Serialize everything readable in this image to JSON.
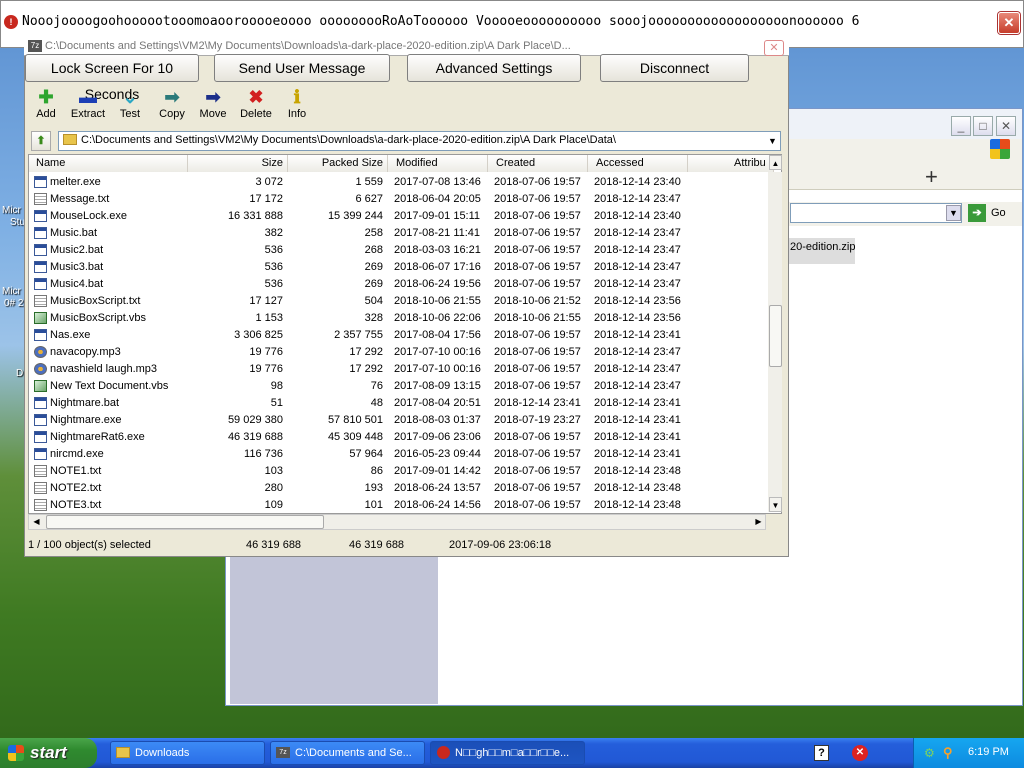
{
  "rat_window": {
    "title": "Nooojoooogoohoooootooomoaoorooooeoooo ooooooooRoAoToooooo Vooooeoooooooooo sooojoooooooooooooooooonoooooo 6",
    "buttons": [
      "Lock Screen For 10 Seconds",
      "Send User Message",
      "Advanced Settings",
      "Disconnect"
    ]
  },
  "zip_window": {
    "title": "C:\\Documents and Settings\\VM2\\My Documents\\Downloads\\a-dark-place-2020-edition.zip\\A Dark Place\\D...",
    "toolbar": [
      {
        "label": "Add",
        "icon": "plus-icon"
      },
      {
        "label": "Extract",
        "icon": "minus-icon"
      },
      {
        "label": "Test",
        "icon": "check-icon"
      },
      {
        "label": "Copy",
        "icon": "copy-arrow-icon"
      },
      {
        "label": "Move",
        "icon": "move-arrow-icon"
      },
      {
        "label": "Delete",
        "icon": "delete-x-icon"
      },
      {
        "label": "Info",
        "icon": "info-icon"
      }
    ],
    "path": "C:\\Documents and Settings\\VM2\\My Documents\\Downloads\\a-dark-place-2020-edition.zip\\A Dark Place\\Data\\",
    "columns": [
      "Name",
      "Size",
      "Packed Size",
      "Modified",
      "Created",
      "Accessed",
      "Attribu"
    ],
    "rows": [
      {
        "type": "exe",
        "name": "melter.exe",
        "size": "3 072",
        "packed": "1 559",
        "modified": "2017-07-08 13:46",
        "created": "2018-07-06 19:57",
        "accessed": "2018-12-14 23:40"
      },
      {
        "type": "txt",
        "name": "Message.txt",
        "size": "17 172",
        "packed": "6 627",
        "modified": "2018-06-04 20:05",
        "created": "2018-07-06 19:57",
        "accessed": "2018-12-14 23:47"
      },
      {
        "type": "exe",
        "name": "MouseLock.exe",
        "size": "16 331 888",
        "packed": "15 399 244",
        "modified": "2017-09-01 15:11",
        "created": "2018-07-06 19:57",
        "accessed": "2018-12-14 23:40"
      },
      {
        "type": "exe",
        "name": "Music.bat",
        "size": "382",
        "packed": "258",
        "modified": "2017-08-21 11:41",
        "created": "2018-07-06 19:57",
        "accessed": "2018-12-14 23:47"
      },
      {
        "type": "exe",
        "name": "Music2.bat",
        "size": "536",
        "packed": "268",
        "modified": "2018-03-03 16:21",
        "created": "2018-07-06 19:57",
        "accessed": "2018-12-14 23:47"
      },
      {
        "type": "exe",
        "name": "Music3.bat",
        "size": "536",
        "packed": "269",
        "modified": "2018-06-07 17:16",
        "created": "2018-07-06 19:57",
        "accessed": "2018-12-14 23:47"
      },
      {
        "type": "exe",
        "name": "Music4.bat",
        "size": "536",
        "packed": "269",
        "modified": "2018-06-24 19:56",
        "created": "2018-07-06 19:57",
        "accessed": "2018-12-14 23:47"
      },
      {
        "type": "txt",
        "name": "MusicBoxScript.txt",
        "size": "17 127",
        "packed": "504",
        "modified": "2018-10-06 21:55",
        "created": "2018-10-06 21:52",
        "accessed": "2018-12-14 23:56"
      },
      {
        "type": "vbs",
        "name": "MusicBoxScript.vbs",
        "size": "1 153",
        "packed": "328",
        "modified": "2018-10-06 22:06",
        "created": "2018-10-06 21:55",
        "accessed": "2018-12-14 23:56"
      },
      {
        "type": "exe",
        "name": "Nas.exe",
        "size": "3 306 825",
        "packed": "2 357 755",
        "modified": "2017-08-04 17:56",
        "created": "2018-07-06 19:57",
        "accessed": "2018-12-14 23:41"
      },
      {
        "type": "mp3",
        "name": "navacopy.mp3",
        "size": "19 776",
        "packed": "17 292",
        "modified": "2017-07-10 00:16",
        "created": "2018-07-06 19:57",
        "accessed": "2018-12-14 23:47"
      },
      {
        "type": "mp3",
        "name": "navashield laugh.mp3",
        "size": "19 776",
        "packed": "17 292",
        "modified": "2017-07-10 00:16",
        "created": "2018-07-06 19:57",
        "accessed": "2018-12-14 23:47"
      },
      {
        "type": "vbs",
        "name": "New Text Document.vbs",
        "size": "98",
        "packed": "76",
        "modified": "2017-08-09 13:15",
        "created": "2018-07-06 19:57",
        "accessed": "2018-12-14 23:47"
      },
      {
        "type": "exe",
        "name": "Nightmare.bat",
        "size": "51",
        "packed": "48",
        "modified": "2017-08-04 20:51",
        "created": "2018-12-14 23:41",
        "accessed": "2018-12-14 23:41"
      },
      {
        "type": "exe",
        "name": "Nightmare.exe",
        "size": "59 029 380",
        "packed": "57 810 501",
        "modified": "2018-08-03 01:37",
        "created": "2018-07-19 23:27",
        "accessed": "2018-12-14 23:41"
      },
      {
        "type": "exe",
        "name": "NightmareRat6.exe",
        "size": "46 319 688",
        "packed": "45 309 448",
        "modified": "2017-09-06 23:06",
        "created": "2018-07-06 19:57",
        "accessed": "2018-12-14 23:41"
      },
      {
        "type": "exe",
        "name": "nircmd.exe",
        "size": "116 736",
        "packed": "57 964",
        "modified": "2016-05-23 09:44",
        "created": "2018-07-06 19:57",
        "accessed": "2018-12-14 23:41"
      },
      {
        "type": "txt",
        "name": "NOTE1.txt",
        "size": "103",
        "packed": "86",
        "modified": "2017-09-01 14:42",
        "created": "2018-07-06 19:57",
        "accessed": "2018-12-14 23:48"
      },
      {
        "type": "txt",
        "name": "NOTE2.txt",
        "size": "280",
        "packed": "193",
        "modified": "2018-06-24 13:57",
        "created": "2018-07-06 19:57",
        "accessed": "2018-12-14 23:48"
      },
      {
        "type": "txt",
        "name": "NOTE3.txt",
        "size": "109",
        "packed": "101",
        "modified": "2018-06-24 14:56",
        "created": "2018-07-06 19:57",
        "accessed": "2018-12-14 23:48"
      }
    ],
    "status": {
      "selected": "1 / 100 object(s) selected",
      "size": "46 319 688",
      "packed": "46 319 688",
      "modified": "2017-09-06 23:06:18"
    }
  },
  "bg_window": {
    "go_label": "Go",
    "file_frag": "20-edition.zip"
  },
  "desktop_frags": [
    "Micr",
    "Stu",
    "Micr",
    "0# 2",
    "D"
  ],
  "taskbar": {
    "start_label": "start",
    "tasks": [
      "Downloads",
      "C:\\Documents and Se...",
      "N□□gh□□m□a□□r□□e..."
    ],
    "clock": "6:19 PM"
  }
}
